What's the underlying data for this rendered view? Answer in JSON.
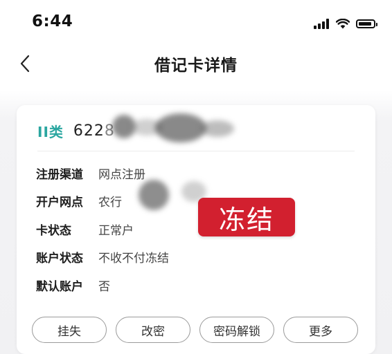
{
  "status_bar": {
    "time": "6:44"
  },
  "nav": {
    "title": "借记卡详情"
  },
  "card": {
    "type_label": "II类",
    "number_visible": "622",
    "number_partial": "8"
  },
  "info": [
    {
      "label": "注册渠道",
      "value": "网点注册"
    },
    {
      "label": "开户网点",
      "value": "农行"
    },
    {
      "label": "卡状态",
      "value": "正常户"
    },
    {
      "label": "账户状态",
      "value": "不收不付冻结"
    },
    {
      "label": "默认账户",
      "value": "否"
    }
  ],
  "stamp": {
    "text": "冻结",
    "color": "#d2202f"
  },
  "actions": [
    {
      "label": "挂失"
    },
    {
      "label": "改密"
    },
    {
      "label": "密码解锁"
    },
    {
      "label": "更多"
    }
  ],
  "colors": {
    "accent": "#2aa6a0",
    "stamp": "#d2202f"
  }
}
